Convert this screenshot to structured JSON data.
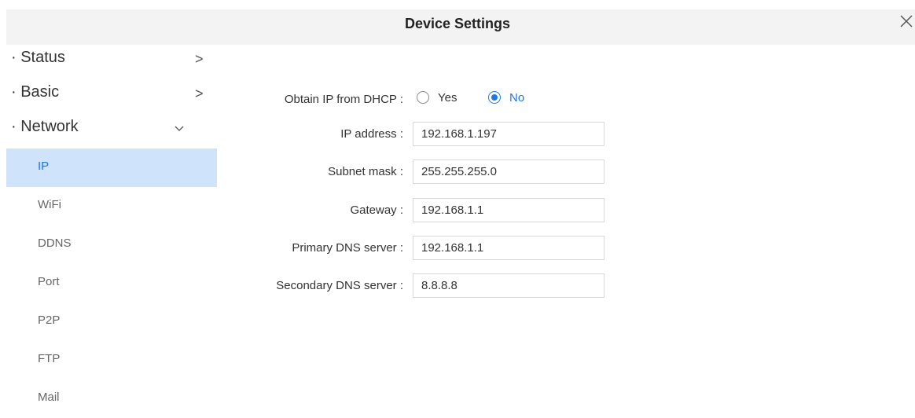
{
  "header": {
    "title": "Device Settings"
  },
  "sidebar": {
    "sections": [
      {
        "label": "· Status",
        "chevron": ">"
      },
      {
        "label": "· Basic",
        "chevron": ">"
      },
      {
        "label": "· Network",
        "chevron": "v"
      }
    ],
    "network_items": [
      {
        "label": "IP",
        "active": true
      },
      {
        "label": "WiFi"
      },
      {
        "label": "DDNS"
      },
      {
        "label": "Port"
      },
      {
        "label": "P2P"
      },
      {
        "label": "FTP"
      },
      {
        "label": "Mail"
      }
    ]
  },
  "form": {
    "dhcp": {
      "label": "Obtain IP from DHCP :",
      "yes": "Yes",
      "no": "No",
      "selected": "No"
    },
    "fields": [
      {
        "label": "IP address :",
        "value": "192.168.1.197"
      },
      {
        "label": "Subnet mask :",
        "value": "255.255.255.0"
      },
      {
        "label": "Gateway :",
        "value": "192.168.1.1"
      },
      {
        "label": "Primary DNS server :",
        "value": "192.168.1.1"
      },
      {
        "label": "Secondary DNS server :",
        "value": "8.8.8.8"
      }
    ]
  },
  "colors": {
    "accent": "#1e78e6",
    "active_bg": "#cfe4fa",
    "header_bg": "#f3f3f3"
  }
}
